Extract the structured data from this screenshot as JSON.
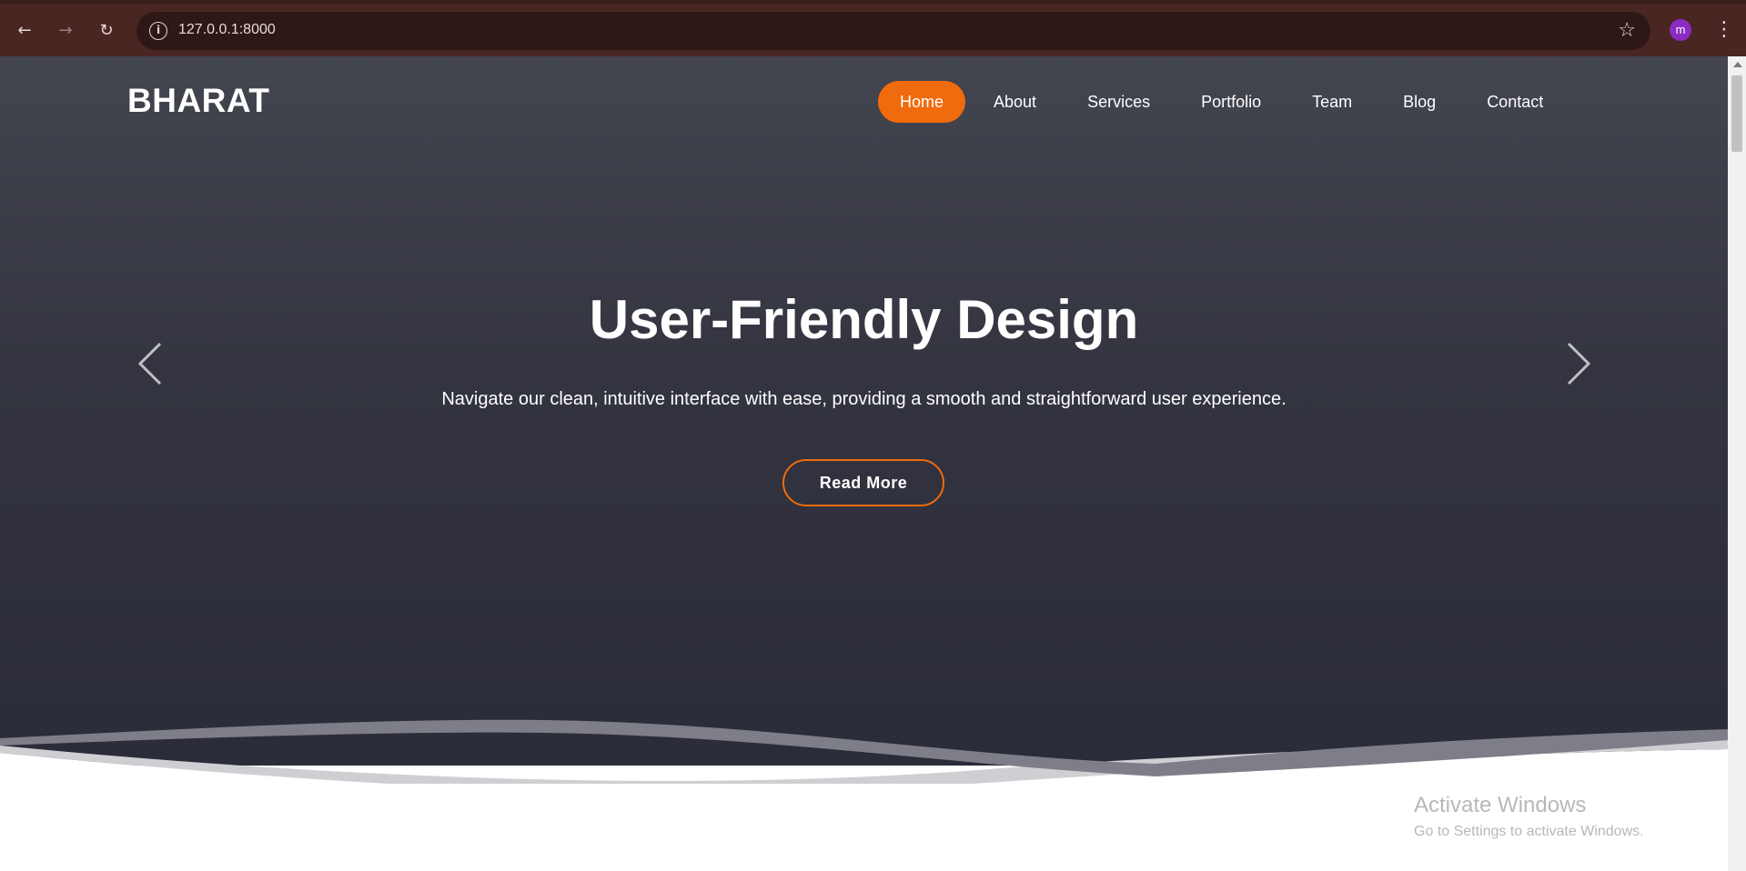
{
  "browser": {
    "url": "127.0.0.1:8000",
    "profile_initial": "m"
  },
  "site": {
    "logo": "BHARAT",
    "nav": [
      {
        "label": "Home",
        "active": true
      },
      {
        "label": "About",
        "active": false
      },
      {
        "label": "Services",
        "active": false
      },
      {
        "label": "Portfolio",
        "active": false
      },
      {
        "label": "Team",
        "active": false
      },
      {
        "label": "Blog",
        "active": false
      },
      {
        "label": "Contact",
        "active": false
      }
    ],
    "hero": {
      "title": "User-Friendly Design",
      "text": "Navigate our clean, intuitive interface with ease, providing a smooth and straightforward user experience.",
      "button": "Read More"
    }
  },
  "watermark": {
    "title": "Activate Windows",
    "subtitle": "Go to Settings to activate Windows."
  },
  "icons": [
    "back-icon",
    "forward-icon",
    "reload-icon",
    "info-icon",
    "star-icon",
    "menu-icon",
    "chevron-left-icon",
    "chevron-right-icon"
  ],
  "colors": {
    "accent": "#f06b0d",
    "browser_frame": "#4a2623",
    "hero_top": "#43454f",
    "hero_bottom": "#2b2c39"
  }
}
